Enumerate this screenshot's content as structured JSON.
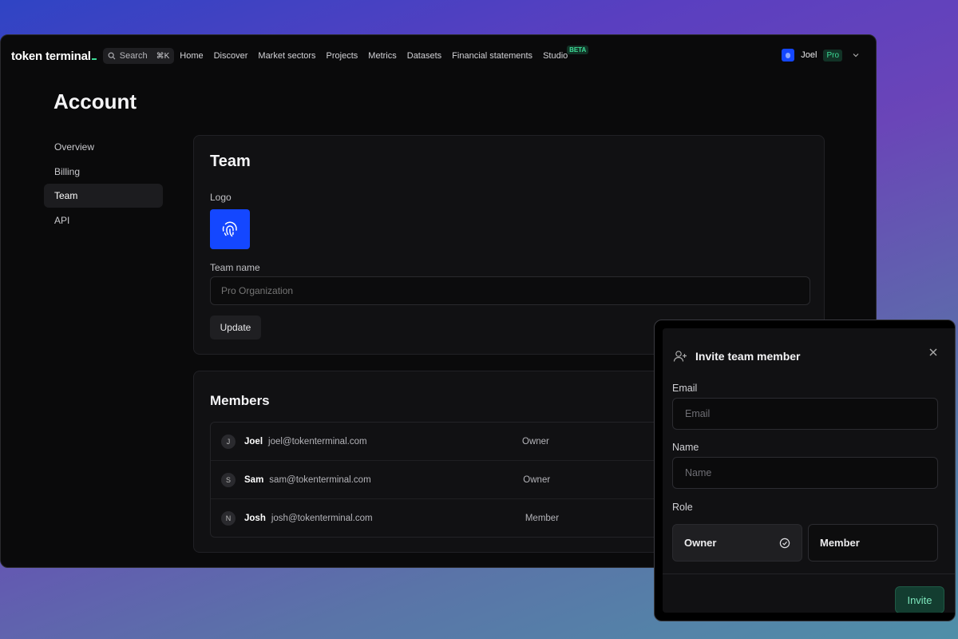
{
  "app": {
    "brand": "token terminal",
    "search": {
      "label": "Search",
      "shortcut": "⌘K"
    },
    "nav": [
      {
        "label": "Home"
      },
      {
        "label": "Discover"
      },
      {
        "label": "Market sectors"
      },
      {
        "label": "Projects"
      },
      {
        "label": "Metrics"
      },
      {
        "label": "Datasets"
      },
      {
        "label": "Financial statements"
      },
      {
        "label": "Studio",
        "badge": "BETA"
      }
    ],
    "user": {
      "name": "Joel",
      "plan": "Pro",
      "avatar_color": "#1447ff"
    }
  },
  "page": {
    "title": "Account"
  },
  "sidebar": {
    "items": [
      {
        "label": "Overview",
        "active": false
      },
      {
        "label": "Billing",
        "active": false
      },
      {
        "label": "Team",
        "active": true
      },
      {
        "label": "API",
        "active": false
      }
    ]
  },
  "team": {
    "title": "Team",
    "logo_label": "Logo",
    "logo_icon": "fingerprint-icon",
    "logo_color": "#1447ff",
    "name_label": "Team name",
    "name_placeholder": "Pro Organization",
    "update_label": "Update"
  },
  "members": {
    "title": "Members",
    "rows": [
      {
        "initial": "J",
        "name": "Joel",
        "email": "joel@tokenterminal.com",
        "role": "Owner"
      },
      {
        "initial": "S",
        "name": "Sam",
        "email": "sam@tokenterminal.com",
        "role": "Owner"
      },
      {
        "initial": "N",
        "name": "Josh",
        "email": "josh@tokenterminal.com",
        "role": "Member"
      }
    ]
  },
  "invite_modal": {
    "title": "Invite team member",
    "email_label": "Email",
    "email_placeholder": "Email",
    "name_label": "Name",
    "name_placeholder": "Name",
    "role_label": "Role",
    "roles": [
      {
        "label": "Owner",
        "selected": true
      },
      {
        "label": "Member",
        "selected": false
      }
    ],
    "invite_label": "Invite",
    "accent_color": "#3ddc97"
  }
}
